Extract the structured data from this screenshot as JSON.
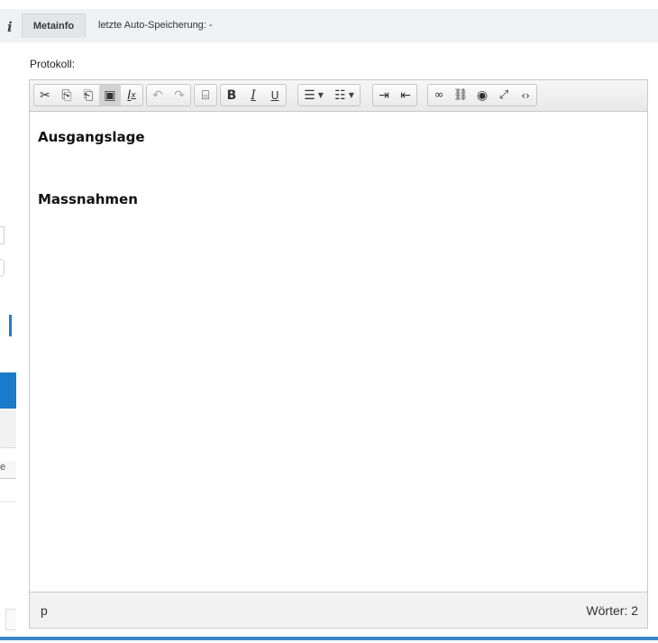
{
  "topbar": {
    "info_icon": "i",
    "tab_label": "Metainfo",
    "autosave_text": "letzte Auto-Speicherung: -"
  },
  "left_edge": {
    "partial_label": "e"
  },
  "field": {
    "label": "Protokoll:"
  },
  "toolbar": {
    "groups": [
      {
        "name": "clipboard",
        "buttons": [
          {
            "icon": "cut-icon",
            "glyph": "✂"
          },
          {
            "icon": "copy-icon",
            "glyph": "⧉"
          },
          {
            "icon": "paste-icon",
            "glyph": "📋"
          },
          {
            "icon": "paste-text-icon",
            "glyph": "▣"
          },
          {
            "icon": "remove-format-icon",
            "glyph": "Iₓ"
          }
        ]
      },
      {
        "name": "history",
        "buttons": [
          {
            "icon": "undo-icon",
            "glyph": "↶"
          },
          {
            "icon": "redo-icon",
            "glyph": "↷"
          }
        ]
      },
      {
        "name": "break",
        "buttons": [
          {
            "icon": "page-break-icon",
            "glyph": "⌸"
          }
        ]
      },
      {
        "name": "basicstyles",
        "buttons": [
          {
            "icon": "bold-icon",
            "glyph": "B"
          },
          {
            "icon": "italic-icon",
            "glyph": "I"
          },
          {
            "icon": "underline-icon",
            "glyph": "U"
          }
        ]
      },
      {
        "name": "lists",
        "buttons": [
          {
            "icon": "bulleted-list-icon",
            "glyph": "☰"
          },
          {
            "icon": "numbered-list-icon",
            "glyph": "⋮☰"
          }
        ]
      },
      {
        "name": "indent",
        "buttons": [
          {
            "icon": "indent-icon",
            "glyph": "⇥"
          },
          {
            "icon": "outdent-icon",
            "glyph": "⇤"
          }
        ]
      },
      {
        "name": "links",
        "buttons": [
          {
            "icon": "link-icon",
            "glyph": "🔗"
          },
          {
            "icon": "unlink-icon",
            "glyph": "⛓"
          },
          {
            "icon": "preview-icon",
            "glyph": "◉"
          },
          {
            "icon": "maximize-icon",
            "glyph": "⛶"
          },
          {
            "icon": "source-icon",
            "glyph": "‹›"
          }
        ]
      }
    ],
    "colors": {
      "border": "#c6c6c6",
      "background": "#eaeaea"
    }
  },
  "content": {
    "headings": [
      "Ausgangslage",
      "Massnahmen"
    ]
  },
  "statusbar": {
    "element_path": "p",
    "word_count": "Wörter: 2"
  },
  "colors": {
    "accent_blue": "#1b7bcb",
    "bottom_bar": "#3a86c8"
  }
}
